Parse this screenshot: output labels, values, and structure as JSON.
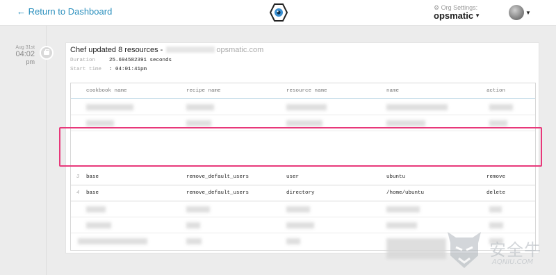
{
  "header": {
    "back_label": "← Return to Dashboard",
    "org_settings_label": "⚙ Org Settings:",
    "org_name": "opsmatic"
  },
  "timeline": {
    "date": "Aug 31st",
    "time": "04:02",
    "ampm": "pm"
  },
  "event": {
    "title_prefix": "Chef updated 8 resources -",
    "title_domain": "opsmatic.com",
    "duration_label": "Duration",
    "duration_value": "25.694582391 seconds",
    "start_label": "Start time",
    "start_value": ": 04:01:41pm"
  },
  "table": {
    "columns": [
      "cookbook name",
      "recipe name",
      "resource name",
      "name",
      "action"
    ],
    "visible_rows": [
      {
        "num": "3",
        "cookbook": "base",
        "recipe": "remove_default_users",
        "resource": "user",
        "name": "ubuntu",
        "action": "remove"
      },
      {
        "num": "4",
        "cookbook": "base",
        "recipe": "remove_default_users",
        "resource": "directory",
        "name": "/home/ubuntu",
        "action": "delete"
      }
    ]
  },
  "watermark": {
    "text": "安全牛",
    "sub": "AQNIU.COM"
  },
  "colors": {
    "link": "#2a8fbd",
    "highlight": "#e8387a",
    "background": "#ececec"
  }
}
